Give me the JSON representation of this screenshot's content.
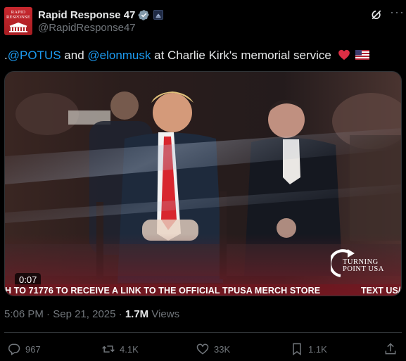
{
  "author": {
    "avatar_text": [
      "RAPID",
      "RESPONSE"
    ],
    "display_name": "Rapid Response 47",
    "handle": "@RapidResponse47"
  },
  "tweet": {
    "prefix": ".",
    "mention1": "@POTUS",
    "mid1": " and ",
    "mention2": "@elonmusk",
    "mid2": " at Charlie Kirk's memorial service"
  },
  "media": {
    "duration": "0:07",
    "ticker": "H TO 71776 TO RECEIVE A LINK TO THE OFFICIAL TPUSA MERCH STORE",
    "ticker_right": "TEXT US/",
    "logo_lines": [
      "TURNING",
      "POINT USA"
    ]
  },
  "meta": {
    "time": "5:06 PM",
    "sep": " · ",
    "date": "Sep 21, 2025",
    "views_num": "1.7M",
    "views_label": " Views"
  },
  "actions": {
    "replies": "967",
    "reposts": "4.1K",
    "likes": "33K",
    "bookmarks": "1.1K"
  },
  "colors": {
    "accent": "#1d9bf0",
    "muted": "#71767b",
    "text": "#e7e9ea",
    "background": "#000000",
    "avatar_red": "#c8282e"
  },
  "icons": {
    "verified": "verified-badge-icon",
    "affiliate": "affiliate-badge-icon",
    "grok": "grok-icon",
    "more": "more-icon",
    "reply": "reply-icon",
    "repost": "repost-icon",
    "like": "like-icon",
    "bookmark": "bookmark-icon",
    "share": "share-icon"
  }
}
